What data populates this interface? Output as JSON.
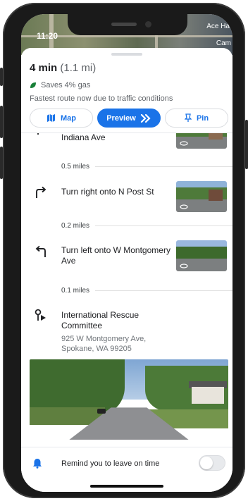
{
  "status_bar": {
    "time": "11:20"
  },
  "map_labels": {
    "top_right": "Ace Ha",
    "right": "Cam"
  },
  "summary": {
    "duration": "4 min",
    "distance": "(1.1 mi)",
    "gas_savings": "Saves 4% gas",
    "route_reason": "Fastest route now due to traffic conditions"
  },
  "actions": {
    "map": "Map",
    "preview": "Preview",
    "pin": "Pin"
  },
  "steps": [
    {
      "instruction": "Indiana Ave",
      "icon": "turn-icon"
    },
    {
      "distance": "0.5 miles"
    },
    {
      "instruction": "Turn right onto N Post St",
      "icon": "turn-right-icon"
    },
    {
      "distance": "0.2 miles"
    },
    {
      "instruction": "Turn left onto W Montgomery Ave",
      "icon": "turn-left-icon"
    },
    {
      "distance": "0.1 miles"
    }
  ],
  "destination": {
    "name": "International Rescue Committee",
    "address_line1": "925 W Montgomery Ave,",
    "address_line2": "Spokane, WA 99205"
  },
  "reminder": {
    "label": "Remind you to leave on time",
    "enabled": false
  },
  "colors": {
    "accent": "#1a73e8",
    "leaf": "#188038"
  }
}
